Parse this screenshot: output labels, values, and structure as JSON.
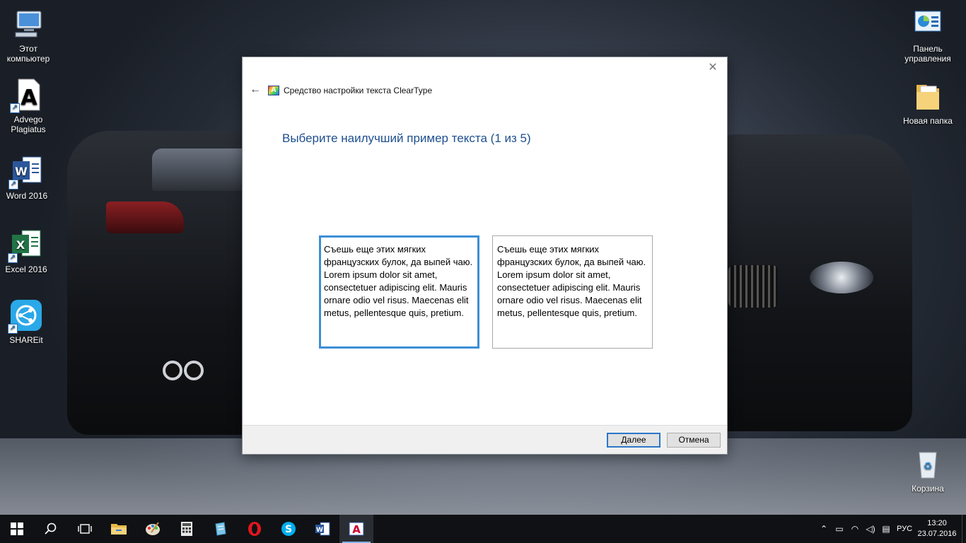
{
  "desktop": {
    "icons_left": [
      {
        "label": "Этот компьютер",
        "icon": "computer-icon"
      },
      {
        "label": "Advego Plagiatus",
        "icon": "advego-icon"
      },
      {
        "label": "Word 2016",
        "icon": "word-icon"
      },
      {
        "label": "Excel 2016",
        "icon": "excel-icon"
      },
      {
        "label": "SHAREit",
        "icon": "shareit-icon"
      }
    ],
    "icons_right": [
      {
        "label": "Панель управления",
        "icon": "control-panel-icon"
      },
      {
        "label": "Новая папка",
        "icon": "folder-icon"
      },
      {
        "label": "Корзина",
        "icon": "recycle-bin-icon"
      }
    ]
  },
  "dialog": {
    "app_title": "Средство настройки текста ClearType",
    "heading": "Выберите наилучший пример текста (1 из 5)",
    "samples": [
      {
        "text": "Съешь еще этих мягких французских булок, да выпей чаю. Lorem ipsum dolor sit amet, consectetuer adipiscing elit. Mauris ornare odio vel risus. Maecenas elit metus, pellentesque quis, pretium.",
        "selected": true
      },
      {
        "text": "Съешь еще этих мягких французских булок, да выпей чаю. Lorem ipsum dolor sit amet, consectetuer adipiscing elit. Mauris ornare odio vel risus. Maecenas elit metus, pellentesque quis, pretium.",
        "selected": false
      }
    ],
    "next_label": "Далее",
    "cancel_label": "Отмена",
    "close_glyph": "✕",
    "back_glyph": "←"
  },
  "taskbar": {
    "apps": [
      "start",
      "search",
      "task-view",
      "file-explorer",
      "paint",
      "calculator",
      "notepad",
      "opera",
      "skype",
      "word",
      "cleartype"
    ],
    "language": "РУС",
    "time": "13:20",
    "date": "23.07.2016"
  },
  "colors": {
    "heading": "#1e4f8e",
    "selected_border": "#3d8fd6",
    "taskbar": "#0f1114"
  }
}
